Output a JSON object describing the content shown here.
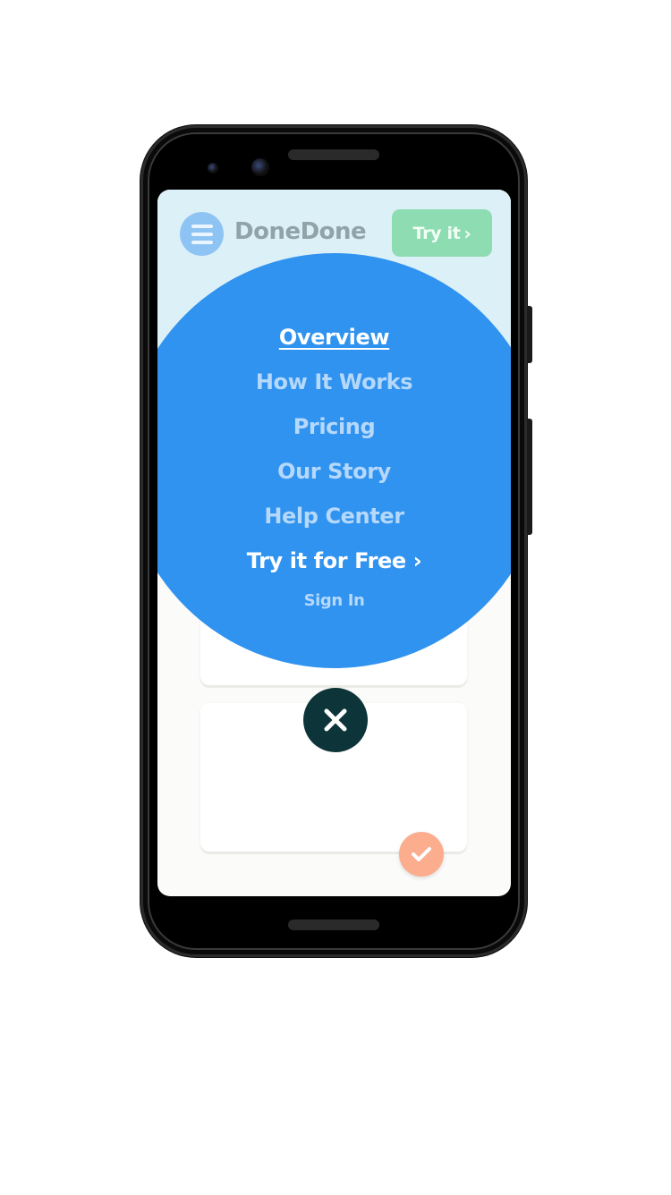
{
  "header": {
    "brand": "DoneDone",
    "try_label": "Try it",
    "try_chevron": "›"
  },
  "menu": {
    "items": [
      {
        "label": "Overview",
        "active": true
      },
      {
        "label": "How It Works"
      },
      {
        "label": "Pricing"
      },
      {
        "label": "Our Story"
      },
      {
        "label": "Help Center"
      }
    ],
    "cta_label": "Try it for Free",
    "cta_chevron": "›",
    "signin_label": "Sign In"
  },
  "colors": {
    "menu_circle": "#3093ef",
    "close_button": "#0d3539",
    "check_button": "#fbad8e",
    "try_button": "#8edcb2",
    "hero_background": "#dcf0f8"
  },
  "icons": {
    "menu": "hamburger-icon",
    "close": "close-icon",
    "check": "checkmark-icon",
    "chevron": "chevron-right-icon"
  }
}
